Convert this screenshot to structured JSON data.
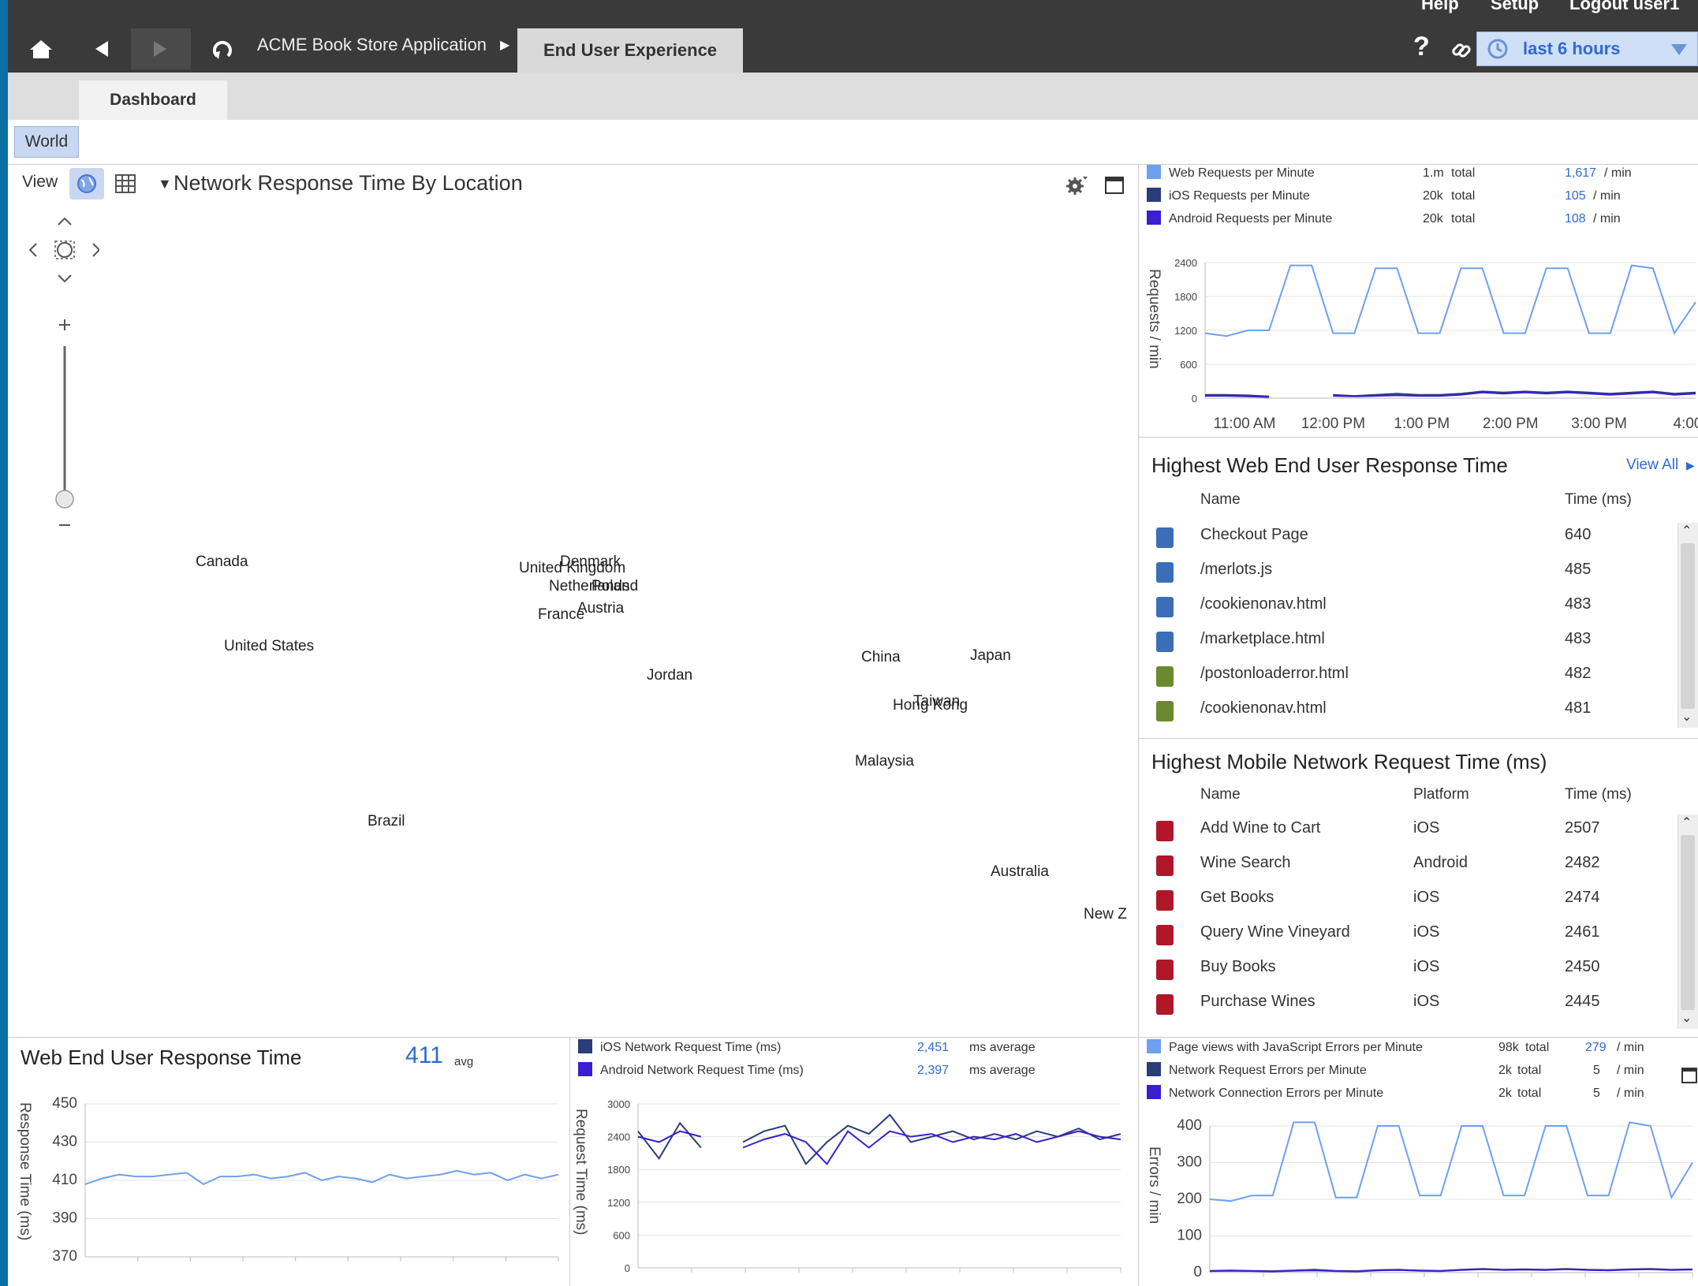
{
  "topbar": {
    "cut_menu": [
      "Help",
      "Setup",
      "Logout user1"
    ],
    "breadcrumb": "ACME Book Store Application",
    "active_tab": "End User Experience",
    "help_label": "?",
    "time_range": "last 6 hours"
  },
  "tabs": {
    "dashboard": "Dashboard"
  },
  "scope": {
    "world": "World"
  },
  "map": {
    "view_label": "View",
    "title": "Network Response Time By Location",
    "locations": [
      "Canada",
      "United States",
      "Brazil",
      "United Kingdom",
      "Denmark",
      "Netherlands",
      "Poland",
      "France",
      "Austria",
      "Jordan",
      "China",
      "Japan",
      "Hong Kong",
      "Taiwan",
      "Malaysia",
      "Australia",
      "New Z"
    ],
    "colors": {
      "high": "#e07a7a",
      "medium": "#f0b060",
      "low": "#9ad58a"
    }
  },
  "web_requests": {
    "legend": [
      {
        "name": "Web Requests per Minute",
        "total": "1.m",
        "total_label": "total",
        "rate": "1,617",
        "unit": "/ min",
        "color": "#6ea0f0"
      },
      {
        "name": "iOS Requests per Minute",
        "total": "20k",
        "total_label": "total",
        "rate": "105",
        "unit": "/ min",
        "color": "#2a3d7a"
      },
      {
        "name": "Android Requests per Minute",
        "total": "20k",
        "total_label": "total",
        "rate": "108",
        "unit": "/ min",
        "color": "#3a1fd0"
      }
    ],
    "ylabel": "Requests / min",
    "xticks": [
      "11:00 AM",
      "12:00 PM",
      "1:00 PM",
      "2:00 PM",
      "3:00 PM",
      "4:00"
    ]
  },
  "web_eu": {
    "title": "Highest Web End User Response Time",
    "view_all": "View All",
    "col_name": "Name",
    "col_time": "Time (ms)",
    "rows": [
      {
        "name": "Checkout Page",
        "time": "640"
      },
      {
        "name": "/merlots.js",
        "time": "485"
      },
      {
        "name": "/cookienonav.html",
        "time": "483"
      },
      {
        "name": "/marketplace.html",
        "time": "483"
      },
      {
        "name": "/postonloaderror.html",
        "time": "482"
      },
      {
        "name": "/cookienonav.html",
        "time": "481"
      }
    ]
  },
  "mobile_net": {
    "title": "Highest Mobile Network Request Time (ms)",
    "col_name": "Name",
    "col_platform": "Platform",
    "col_time": "Time (ms)",
    "rows": [
      {
        "name": "Add Wine to Cart",
        "platform": "iOS",
        "time": "2507"
      },
      {
        "name": "Wine Search",
        "platform": "Android",
        "time": "2482"
      },
      {
        "name": "Get Books",
        "platform": "iOS",
        "time": "2474"
      },
      {
        "name": "Query Wine Vineyard",
        "platform": "iOS",
        "time": "2461"
      },
      {
        "name": "Buy Books",
        "platform": "iOS",
        "time": "2450"
      },
      {
        "name": "Purchase Wines",
        "platform": "iOS",
        "time": "2445"
      }
    ]
  },
  "web_eu_time": {
    "title": "Web End User Response Time",
    "avg_value": "411",
    "avg_label": "avg",
    "ylabel": "Response Time (ms)"
  },
  "mobile_req": {
    "legend": [
      {
        "name": "iOS Network Request Time (ms)",
        "value": "2,451",
        "unit": "ms average",
        "color": "#2a3d7a"
      },
      {
        "name": "Android Network Request Time (ms)",
        "value": "2,397",
        "unit": "ms average",
        "color": "#3a1fd0"
      }
    ],
    "ylabel": "Request Time (ms)"
  },
  "errors": {
    "legend": [
      {
        "name": "Page views with JavaScript Errors per Minute",
        "total": "98k",
        "total_label": "total",
        "rate": "279",
        "unit": "/ min",
        "color": "#6ea0f0"
      },
      {
        "name": "Network Request Errors per Minute",
        "total": "2k",
        "total_label": "total",
        "rate": "5",
        "unit": "/ min",
        "color": "#2a3d7a"
      },
      {
        "name": "Network Connection Errors per Minute",
        "total": "2k",
        "total_label": "total",
        "rate": "5",
        "unit": "/ min",
        "color": "#3a1fd0"
      }
    ],
    "ylabel": "Errors / min"
  },
  "chart_data": [
    {
      "type": "line",
      "ylabel": "Requests / min",
      "ylim": [
        0,
        2400
      ],
      "yticks": [
        0,
        600,
        1200,
        1800,
        2400
      ],
      "x": [
        "10:30",
        "10:45",
        "11:00",
        "11:15",
        "11:30",
        "11:45",
        "12:00",
        "12:15",
        "12:30",
        "12:45",
        "13:00",
        "13:15",
        "13:30",
        "13:45",
        "14:00",
        "14:15",
        "14:30",
        "14:45",
        "15:00",
        "15:15",
        "15:30",
        "15:45",
        "16:00",
        "16:15"
      ],
      "series": [
        {
          "name": "Web Requests per Minute",
          "values": [
            1150,
            1100,
            1200,
            1200,
            2350,
            2350,
            1150,
            1150,
            2300,
            2300,
            1150,
            1150,
            2300,
            2300,
            1150,
            1150,
            2300,
            2300,
            1150,
            1150,
            2350,
            2300,
            1150,
            1700
          ]
        },
        {
          "name": "iOS Requests per Minute",
          "values": [
            60,
            60,
            50,
            30,
            null,
            null,
            60,
            40,
            60,
            80,
            60,
            60,
            80,
            120,
            100,
            120,
            100,
            120,
            100,
            80,
            100,
            120,
            80,
            100
          ]
        },
        {
          "name": "Android Requests per Minute",
          "values": [
            40,
            40,
            30,
            20,
            null,
            null,
            40,
            30,
            40,
            50,
            40,
            40,
            60,
            100,
            80,
            100,
            80,
            100,
            80,
            60,
            80,
            100,
            60,
            80
          ]
        }
      ]
    },
    {
      "type": "line",
      "title": "Web End User Response Time",
      "ylabel": "Response Time (ms)",
      "ylim": [
        370,
        450
      ],
      "yticks": [
        370,
        390,
        410,
        430,
        450
      ],
      "series": [
        {
          "name": "Web End User Response Time",
          "values": [
            408,
            411,
            413,
            412,
            412,
            413,
            414,
            408,
            412,
            412,
            413,
            411,
            412,
            414,
            410,
            412,
            411,
            409,
            413,
            411,
            412,
            413,
            415,
            413,
            414,
            410,
            413,
            411,
            413
          ]
        }
      ]
    },
    {
      "type": "line",
      "ylabel": "Request Time (ms)",
      "ylim": [
        0,
        3000
      ],
      "yticks": [
        0,
        600,
        1200,
        1800,
        2400,
        3000
      ],
      "series": [
        {
          "name": "iOS Network Request Time (ms)",
          "values": [
            2500,
            2000,
            2650,
            2200,
            null,
            2300,
            2500,
            2600,
            1900,
            2300,
            2600,
            2450,
            2800,
            2300,
            2400,
            2500,
            2350,
            2450,
            2350,
            2500,
            2400,
            2550,
            2350,
            2450
          ]
        },
        {
          "name": "Android Network Request Time (ms)",
          "values": [
            2400,
            2300,
            2500,
            2400,
            null,
            2200,
            2350,
            2450,
            2300,
            1900,
            2500,
            2200,
            2500,
            2400,
            2450,
            2300,
            2400,
            2350,
            2450,
            2300,
            2400,
            2500,
            2400,
            2350
          ]
        }
      ]
    },
    {
      "type": "line",
      "ylabel": "Errors / min",
      "ylim": [
        0,
        400
      ],
      "yticks": [
        0,
        100,
        200,
        300,
        400
      ],
      "series": [
        {
          "name": "Page views with JavaScript Errors per Minute",
          "values": [
            200,
            195,
            210,
            210,
            410,
            410,
            205,
            205,
            400,
            400,
            210,
            210,
            400,
            400,
            210,
            210,
            400,
            400,
            210,
            210,
            410,
            400,
            205,
            300
          ]
        },
        {
          "name": "Network Request Errors per Minute",
          "values": [
            5,
            6,
            5,
            4,
            6,
            8,
            5,
            4,
            7,
            8,
            6,
            5,
            8,
            10,
            8,
            9,
            8,
            10,
            8,
            7,
            9,
            10,
            8,
            9
          ]
        },
        {
          "name": "Network Connection Errors per Minute",
          "values": [
            4,
            5,
            4,
            3,
            5,
            6,
            4,
            3,
            6,
            7,
            5,
            4,
            7,
            9,
            7,
            8,
            7,
            9,
            7,
            6,
            8,
            9,
            7,
            8
          ]
        }
      ]
    }
  ]
}
